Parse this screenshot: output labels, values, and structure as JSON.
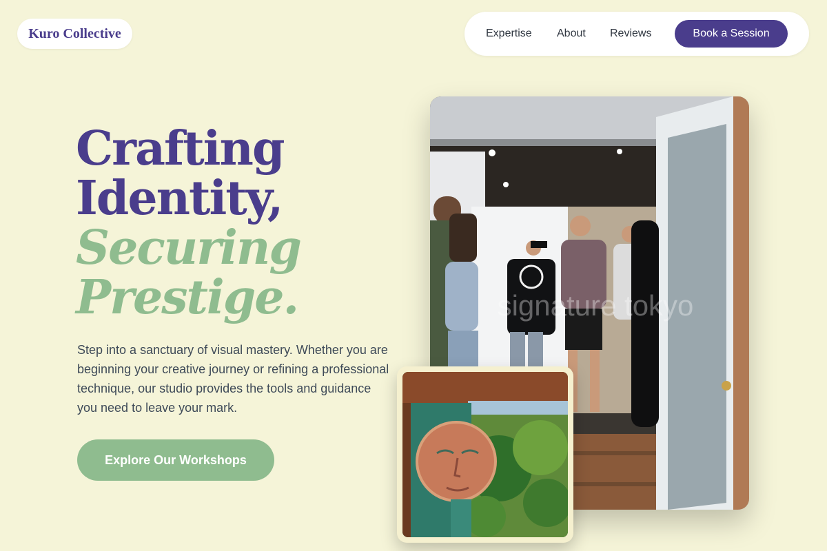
{
  "brand": {
    "name": "Kuro Collective"
  },
  "nav": {
    "links": [
      "Expertise",
      "About",
      "Reviews"
    ],
    "cta_label": "Book a Session"
  },
  "hero": {
    "headline_line1": "Crafting",
    "headline_line2": "Identity,",
    "headline_line3": "Securing",
    "headline_line4": "Prestige.",
    "intro": "Step into a sanctuary of visual mastery. Whether you are beginning your creative journey or refining a professional technique, our studio provides the tools and guidance you need to leave your mark.",
    "cta_label": "Explore Our Workshops"
  },
  "images": {
    "main": {
      "watermark": "signature tokyo"
    }
  },
  "colors": {
    "background": "#f5f4d8",
    "primary": "#4a3d8c",
    "accent": "#8fbc8f",
    "text": "#3e4a58"
  }
}
